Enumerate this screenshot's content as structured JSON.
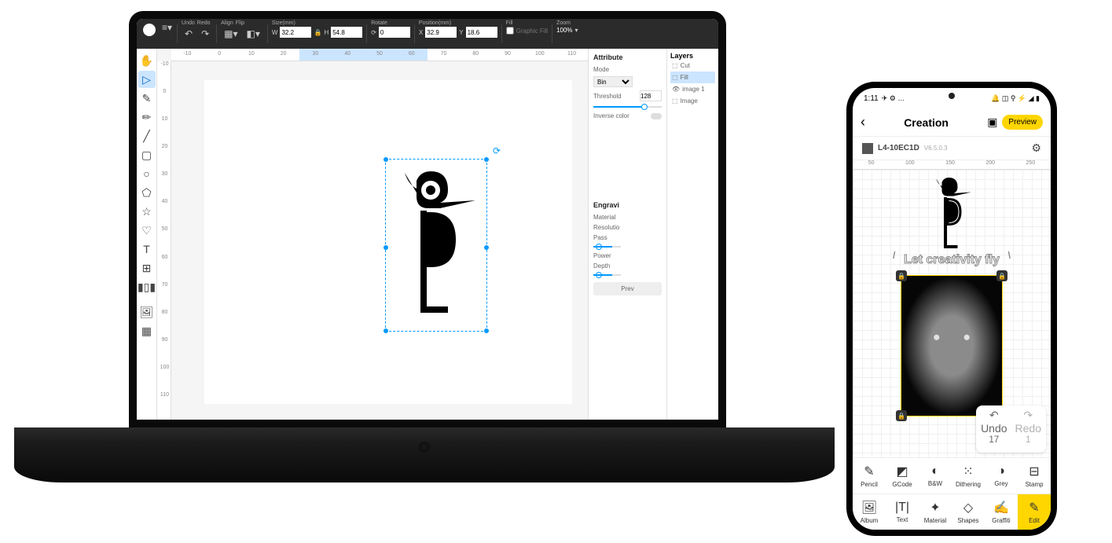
{
  "laptop": {
    "toolbar": {
      "undo": "Undo",
      "redo": "Redo",
      "align": "Align",
      "flip": "Flip",
      "size_label": "Size(mm)",
      "w_prefix": "W",
      "w_value": "32.2",
      "h_prefix": "H",
      "h_value": "54.8",
      "rotate_label": "Rotate",
      "rotate_prefix": "⟳",
      "rotate_value": "0",
      "pos_label": "Position(mm)",
      "x_prefix": "X",
      "x_value": "32.9",
      "y_prefix": "Y",
      "y_value": "18.6",
      "fill_label": "Fill",
      "fill_option": "Graphic Fill",
      "zoom_label": "Zoom",
      "zoom_value": "100%"
    },
    "ruler_h": [
      "-10",
      "0",
      "10",
      "20",
      "30",
      "40",
      "50",
      "60",
      "70",
      "80",
      "90",
      "100",
      "110"
    ],
    "ruler_v": [
      "-10",
      "0",
      "10",
      "20",
      "30",
      "40",
      "50",
      "60",
      "70",
      "80",
      "90",
      "100",
      "110"
    ],
    "attribute": {
      "title": "Attribute",
      "mode_label": "Mode",
      "mode_value": "Bin",
      "threshold_label": "Threshold",
      "threshold_value": "128",
      "inverse_label": "Inverse color"
    },
    "engrave": {
      "title": "Engravi",
      "material": "Material",
      "resolution": "Resolutio",
      "pass": "Pass",
      "power": "Power",
      "depth": "Depth",
      "preview_btn": "Prev"
    },
    "layers": {
      "title": "Layers",
      "items": [
        {
          "icon": "⬚",
          "name": "Cut"
        },
        {
          "icon": "⬚",
          "name": "Fill"
        },
        {
          "icon": "👁",
          "name": "image 1"
        },
        {
          "icon": "⬚",
          "name": "Image"
        }
      ]
    }
  },
  "phone": {
    "status": {
      "time": "1:11",
      "icons_left": "✈ ⚙ …",
      "icons_right": "🔔 ◫ ⚲ ⚡ ◢ ▮"
    },
    "header": {
      "title": "Creation",
      "preview": "Preview"
    },
    "device": {
      "name": "L4-10EC1D",
      "ver": "V6.5.0.3"
    },
    "ruler": [
      "50",
      "100",
      "150",
      "200",
      "250"
    ],
    "creative_text": "Let creativity fly",
    "undo": {
      "undo_label": "Undo",
      "undo_sup": "17",
      "redo_label": "Redo",
      "redo_sup": "1"
    },
    "modes": [
      {
        "icon": "✎",
        "label": "Pencil"
      },
      {
        "icon": "◩",
        "label": "GCode"
      },
      {
        "icon": "◐",
        "label": "B&W"
      },
      {
        "icon": "⁙",
        "label": "Dithering"
      },
      {
        "icon": "◑",
        "label": "Grey"
      },
      {
        "icon": "⊟",
        "label": "Stamp"
      }
    ],
    "tools": [
      {
        "icon": "🖼",
        "label": "Album"
      },
      {
        "icon": "|T|",
        "label": "Text"
      },
      {
        "icon": "✦",
        "label": "Material"
      },
      {
        "icon": "◇",
        "label": "Shapes"
      },
      {
        "icon": "✍",
        "label": "Graffiti"
      },
      {
        "icon": "✎",
        "label": "Edit"
      }
    ]
  }
}
